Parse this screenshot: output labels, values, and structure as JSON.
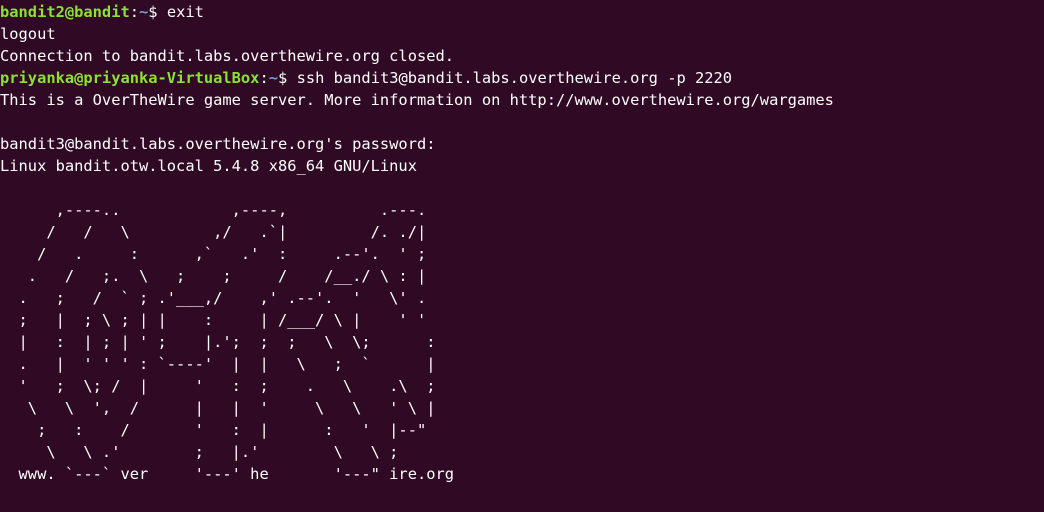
{
  "terminal": {
    "colors": {
      "background": "#300a24",
      "foreground": "#ffffff",
      "prompt_user": "#8ae234",
      "prompt_path": "#729fcf"
    },
    "line1": {
      "user_host": "bandit2@bandit",
      "separator": ":",
      "path": "~",
      "symbol": "$ ",
      "command": "exit"
    },
    "line2": "logout",
    "line3": "Connection to bandit.labs.overthewire.org closed.",
    "line4": {
      "user_host": "priyanka@priyanka-VirtualBox",
      "separator": ":",
      "path": "~",
      "symbol": "$ ",
      "command": "ssh bandit3@bandit.labs.overthewire.org -p 2220"
    },
    "line5": "This is a OverTheWire game server. More information on http://www.overthewire.org/wargames",
    "line6": "",
    "line7": "bandit3@bandit.labs.overthewire.org's password:",
    "line8": "Linux bandit.otw.local 5.4.8 x86_64 GNU/Linux",
    "line9": "",
    "banner": "      ,----..            ,----,          .---.\n     /   /   \\         ,/   .`|         /. ./|\n    /   .     :      ,`   .'  :     .--'.  ' ;\n   .   /   ;.  \\   ;    ;     /    /__./ \\ : |\n  .   ;   /  ` ; .'___,/    ,' .--'.  '   \\' .\n  ;   |  ; \\ ; | |    :     | /___/ \\ |    ' '\n  |   :  | ; | ' ;    |.';  ;  ;   \\  \\;      :\n  .   |  ' ' ' : `----'  |  |   \\   ;  `      |\n  '   ;  \\; /  |     '   :  ;    .   \\    .\\  ;\n   \\   \\  ',  /      |   |  '     \\   \\   ' \\ |\n    ;   :    /       '   :  |      :   '  |--\"\n     \\   \\ .'        ;   |.'        \\   \\ ;\n  www. `---` ver     '---' he       '---\" ire.org"
  }
}
